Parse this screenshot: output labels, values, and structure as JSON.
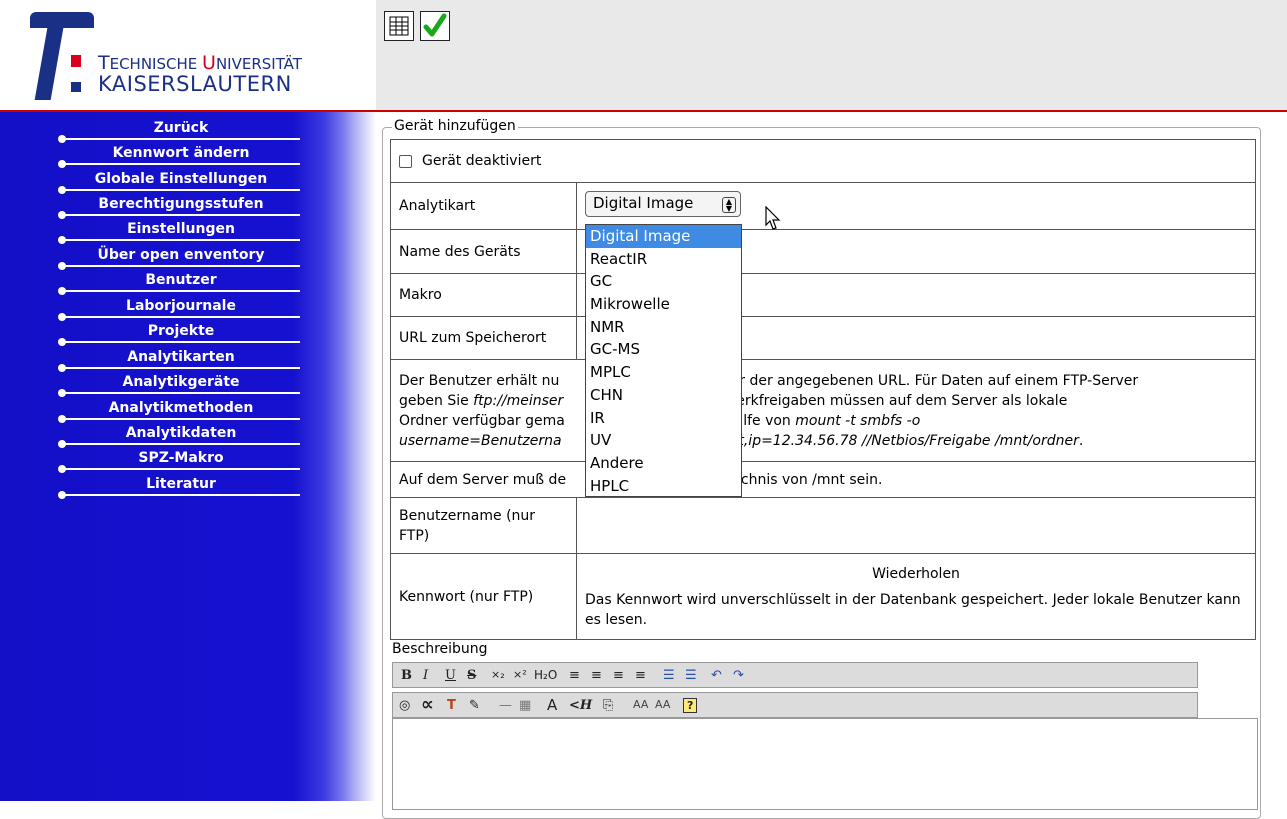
{
  "header": {
    "logo_line1_a": "T",
    "logo_line1_b": "ECHNISCHE ",
    "logo_line1_c": "U",
    "logo_line1_d": "NIVERSITÄT",
    "logo_line2": "KAISERSLAUTERN",
    "toolbar": {
      "table_icon": "table-icon",
      "check_icon": "checkmark-icon"
    }
  },
  "sidebar": {
    "items": [
      {
        "label": "Zurück"
      },
      {
        "label": "Kennwort ändern"
      },
      {
        "label": "Globale Einstellungen"
      },
      {
        "label": "Berechtigungsstufen"
      },
      {
        "label": "Einstellungen"
      },
      {
        "label": "Über open enventory"
      },
      {
        "label": "Benutzer"
      },
      {
        "label": "Laborjournale"
      },
      {
        "label": "Projekte"
      },
      {
        "label": "Analytikarten"
      },
      {
        "label": "Analytikgeräte"
      },
      {
        "label": "Analytikmethoden"
      },
      {
        "label": "Analytikdaten"
      },
      {
        "label": "SPZ-Makro"
      },
      {
        "label": "Literatur"
      }
    ]
  },
  "form": {
    "legend": "Gerät hinzufügen",
    "deactivated_label": "Gerät deaktiviert",
    "analytikart_label": "Analytikart",
    "analytikart_value": "Digital Image",
    "name_label": "Name des Geräts",
    "makro_label": "Makro",
    "url_label": "URL zum Speicherort",
    "info": {
      "l1a": "Der Benutzer erhält nu",
      "l1b": "rdner der angegebenen URL. Für Daten auf einem FTP-Server",
      "l2a": "geben Sie ",
      "l2b": "ftp://meinser",
      "l2c": "Windows-Netzwerkfreigaben müssen auf dem Server als lokale",
      "l3a": "Ordner verfügbar gema",
      "l3b": "t Hilfe von ",
      "l3c": "mount -t smbfs -o",
      "l4a": "username=Benutzerna",
      "l4b": "wort,ip=12.34.56.78 //Netbios/Freigabe /mnt/ordner",
      "l4c": "."
    },
    "server_note_a": "Auf dem Server muß de",
    "server_note_b": "zeichnis von /mnt sein.",
    "username_label": "Benutzername (nur FTP)",
    "password_label": "Kennwort (nur FTP)",
    "repeat_label": "Wiederholen",
    "password_note": "Das Kennwort wird unverschlüsselt in der Datenbank gespeichert. Jeder lokale Benutzer kann es lesen.",
    "description_label": "Beschreibung"
  },
  "dropdown": {
    "options": [
      "Digital Image",
      "ReactIR",
      "GC",
      "Mikrowelle",
      "NMR",
      "GC-MS",
      "MPLC",
      "CHN",
      "IR",
      "UV",
      "Andere",
      "HPLC"
    ],
    "selected_index": 0
  },
  "editor": {
    "row1": {
      "bold": "B",
      "italic": "I",
      "underline": "U",
      "strike": "S",
      "sub": "×₂",
      "sup": "×²",
      "h2o": "H₂O"
    },
    "row2": {
      "aa1": "AA",
      "aa2": "AA",
      "sym": "<H"
    }
  },
  "colors": {
    "sidebar_blue": "#1410c8",
    "accent_red": "#cc0000",
    "logo_blue": "#1a2f86",
    "select_highlight": "#3f8ae2"
  }
}
